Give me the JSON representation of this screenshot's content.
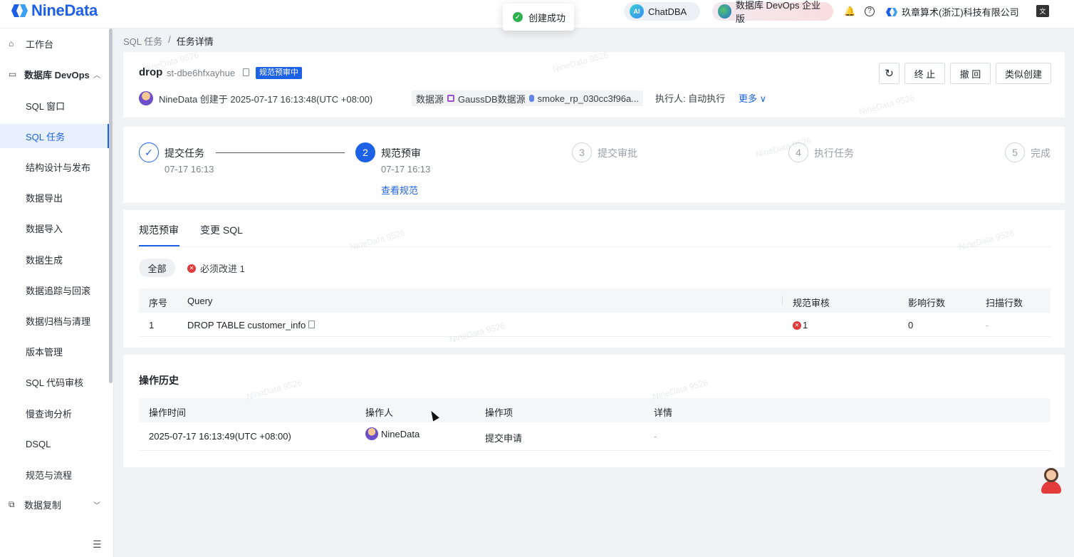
{
  "app": {
    "logo_text": "NineData"
  },
  "toast": {
    "text": "创建成功"
  },
  "topbar": {
    "chat_label": "ChatDBA",
    "chat_badge": "AI",
    "devops_label": "数据库 DevOps 企业版",
    "org_name": "玖章算术(浙江)科技有限公司",
    "lang_badge": "文"
  },
  "sidebar": {
    "workbench": "工作台",
    "group_devops": "数据库 DevOps",
    "items": [
      "SQL 窗口",
      "SQL 任务",
      "结构设计与发布",
      "数据导出",
      "数据导入",
      "数据生成",
      "数据追踪与回滚",
      "数据归档与清理",
      "版本管理",
      "SQL 代码审核",
      "慢查询分析",
      "DSQL",
      "规范与流程"
    ],
    "active_item": "SQL 任务",
    "group_replication": "数据复制"
  },
  "breadcrumb": {
    "parent": "SQL 任务",
    "sep": "/",
    "current": "任务详情"
  },
  "task": {
    "name": "drop",
    "id": "st-dbe6hfxayhue",
    "status": "规范预审中",
    "creator": "NineData 创建于 2025-07-17 16:13:48(UTC +08:00)",
    "datasource_label": "数据源",
    "datasource_name": "GaussDB数据源",
    "database_name": "smoke_rp_030cc3f96a...",
    "executor": "执行人:  自动执行",
    "more": "更多"
  },
  "actions": {
    "stop": "终 止",
    "revoke": "撤 回",
    "clone": "类似创建"
  },
  "steps": [
    {
      "num": "✓",
      "title": "提交任务",
      "date": "07-17 16:13",
      "state": "done"
    },
    {
      "num": "2",
      "title": "规范预审",
      "date": "07-17 16:13",
      "link": "查看规范",
      "state": "current"
    },
    {
      "num": "3",
      "title": "提交审批",
      "state": "pending"
    },
    {
      "num": "4",
      "title": "执行任务",
      "state": "pending"
    },
    {
      "num": "5",
      "title": "完成",
      "state": "pending"
    }
  ],
  "review": {
    "tabs": [
      "规范预审",
      "变更 SQL"
    ],
    "filter_all": "全部",
    "filter_must": "必须改进 1",
    "columns": [
      "序号",
      "Query",
      "规范审核",
      "影响行数",
      "扫描行数"
    ],
    "rows": [
      {
        "index": "1",
        "query": "DROP TABLE customer_info",
        "review": "1",
        "affected": "0",
        "scanned": "-"
      }
    ]
  },
  "history": {
    "title": "操作历史",
    "columns": [
      "操作时间",
      "操作人",
      "操作项",
      "详情"
    ],
    "rows": [
      {
        "time": "2025-07-17 16:13:49(UTC +08:00)",
        "operator": "NineData",
        "action": "提交申请",
        "detail": "-"
      }
    ]
  },
  "watermark": "NineData 9526"
}
